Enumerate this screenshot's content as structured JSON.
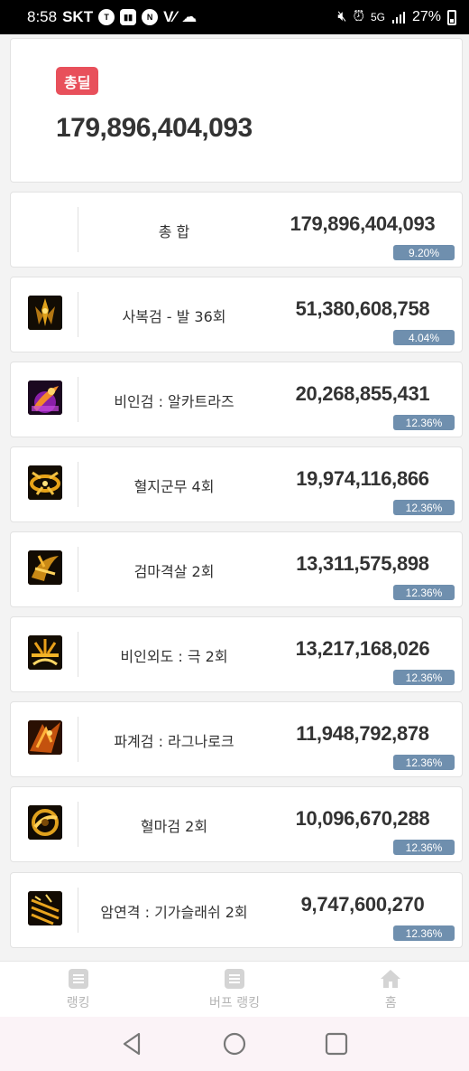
{
  "status_bar": {
    "time": "8:58",
    "carrier": "SKT",
    "left_icons": [
      "talk-icon",
      "twitch-icon",
      "naver-icon",
      "vlive-icon",
      "cloud-icon"
    ],
    "right_icons": [
      "mute-icon",
      "alarm-icon",
      "5g-icon",
      "signal-icon"
    ],
    "network": "5G",
    "battery": "27%"
  },
  "total": {
    "badge": "총딜",
    "value": "179,896,404,093"
  },
  "rows": [
    {
      "icon": "",
      "name": "총 합",
      "value": "179,896,404,093",
      "pct": "9.20%"
    },
    {
      "icon": "skill-icon",
      "name": "사복검 - 발 36회",
      "value": "51,380,608,758",
      "pct": "4.04%"
    },
    {
      "icon": "skill-icon",
      "name": "비인검 : 알카트라즈",
      "value": "20,268,855,431",
      "pct": "12.36%"
    },
    {
      "icon": "skill-icon",
      "name": "혈지군무 4회",
      "value": "19,974,116,866",
      "pct": "12.36%"
    },
    {
      "icon": "skill-icon",
      "name": "검마격살 2회",
      "value": "13,311,575,898",
      "pct": "12.36%"
    },
    {
      "icon": "skill-icon",
      "name": "비인외도 : 극 2회",
      "value": "13,217,168,026",
      "pct": "12.36%"
    },
    {
      "icon": "skill-icon",
      "name": "파계검 : 라그나로크",
      "value": "11,948,792,878",
      "pct": "12.36%"
    },
    {
      "icon": "skill-icon",
      "name": "혈마검 2회",
      "value": "10,096,670,288",
      "pct": "12.36%"
    },
    {
      "icon": "skill-icon",
      "name": "암연격 : 기가슬래쉬 2회",
      "value": "9,747,600,270",
      "pct": "12.36%"
    }
  ],
  "nav": [
    {
      "label": "랭킹",
      "icon": "list-icon"
    },
    {
      "label": "버프 랭킹",
      "icon": "list-icon"
    },
    {
      "label": "홈",
      "icon": "home-icon"
    }
  ],
  "colors": {
    "badge": "#e8505b",
    "pct_bar": "#6f8fae",
    "text": "#333333"
  }
}
